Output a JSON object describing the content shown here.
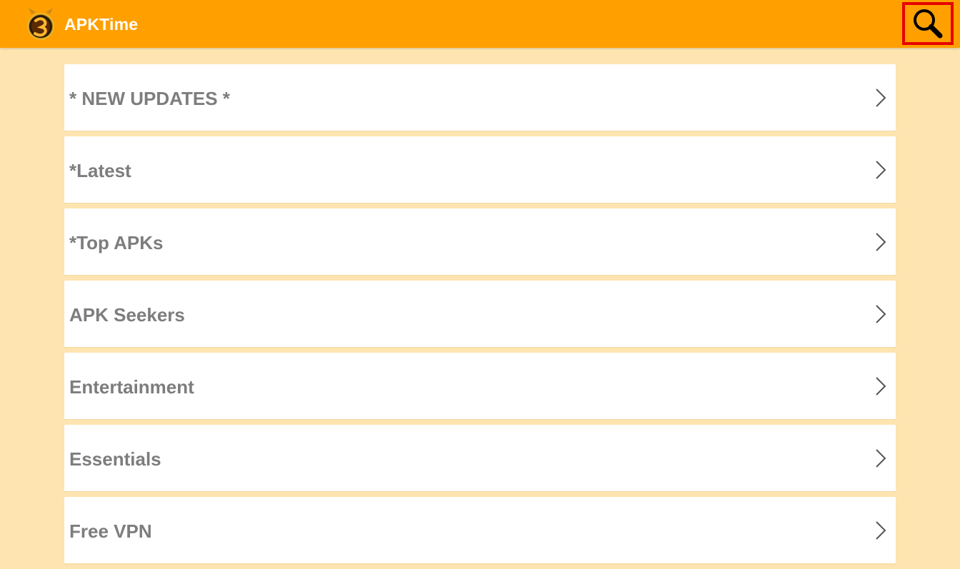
{
  "app_bar": {
    "title": "APKTime",
    "logo_icon": "apktime-logo-icon",
    "search_icon": "search-icon",
    "background_color": "#ffa000",
    "highlight_color": "#e60000"
  },
  "menu": {
    "items": [
      {
        "label": "* NEW UPDATES *"
      },
      {
        "label": "*Latest"
      },
      {
        "label": "*Top APKs"
      },
      {
        "label": "APK Seekers"
      },
      {
        "label": "Entertainment"
      },
      {
        "label": "Essentials"
      },
      {
        "label": "Free VPN"
      }
    ],
    "chevron_icon": "chevron-right-icon",
    "background_color": "#fde4b0",
    "label_color": "#7d7d7d"
  }
}
